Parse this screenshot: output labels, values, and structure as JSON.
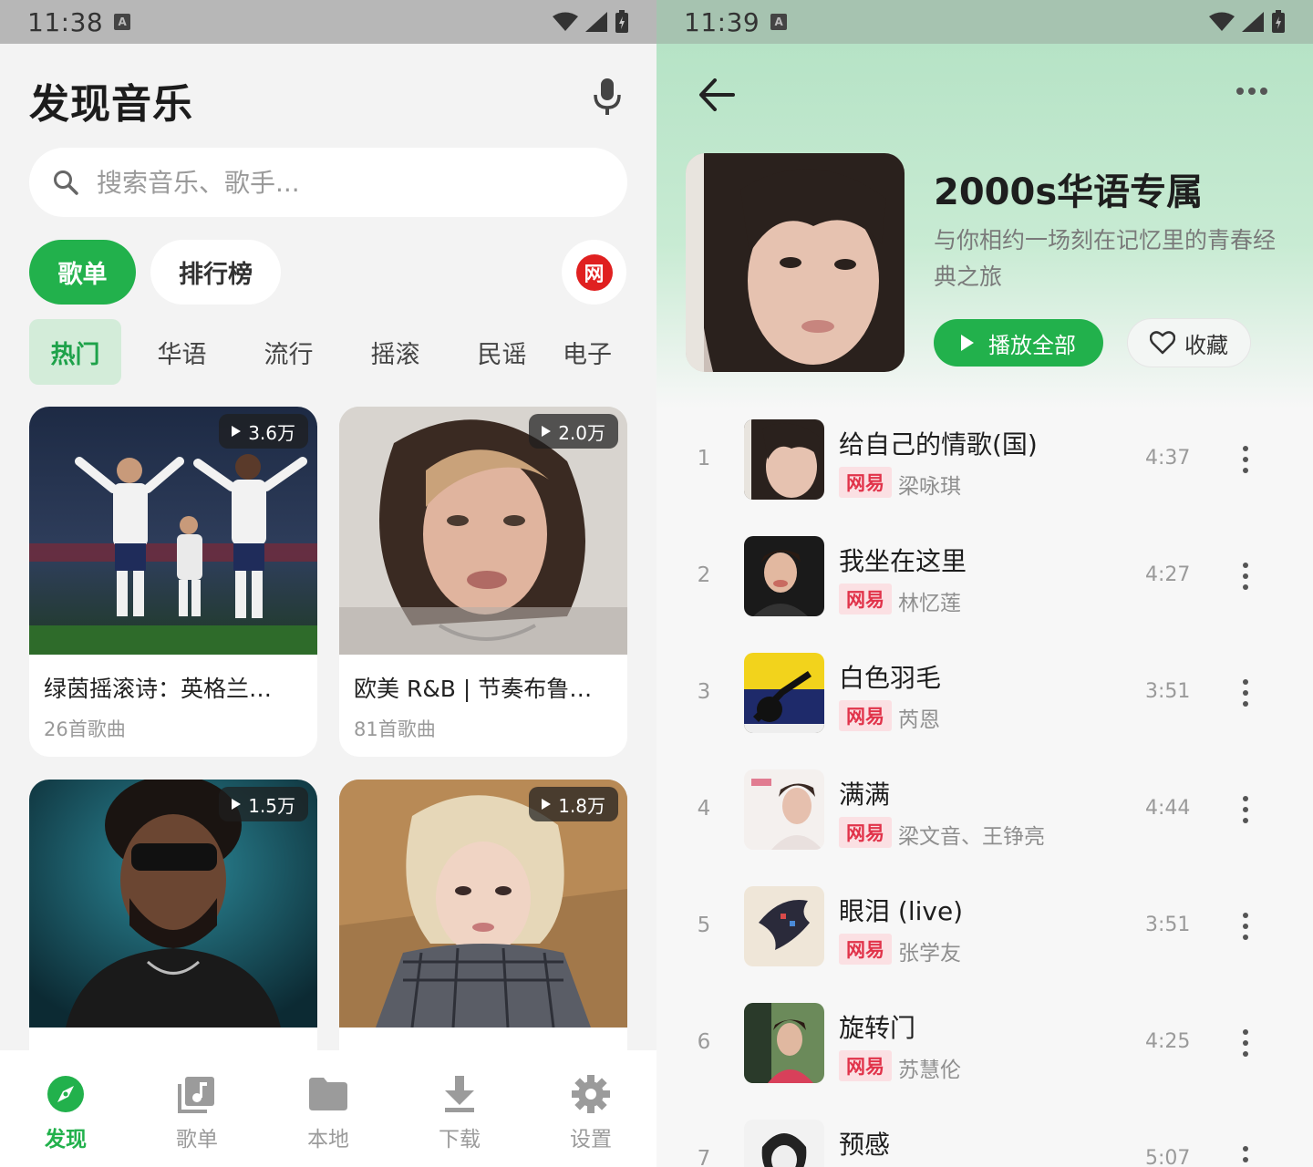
{
  "left": {
    "status": {
      "time": "11:38",
      "badge": "A"
    },
    "title": "发现音乐",
    "search": {
      "placeholder": "搜索音乐、歌手..."
    },
    "pills": {
      "active": "歌单",
      "inactive": "排行榜"
    },
    "source_badge": "网",
    "categories": [
      "热门",
      "华语",
      "流行",
      "摇滚",
      "民谣",
      "电子"
    ],
    "cards": [
      {
        "title": "绿茵摇滚诗：英格兰…",
        "count": "26首歌曲",
        "plays": "3.6万"
      },
      {
        "title": "欧美 R&B | 节奏布鲁…",
        "count": "81首歌曲",
        "plays": "2.0万"
      },
      {
        "title": "",
        "count": "",
        "plays": "1.5万"
      },
      {
        "title": "",
        "count": "",
        "plays": "1.8万"
      }
    ],
    "nav": [
      {
        "label": "发现",
        "icon": "compass-icon",
        "active": true
      },
      {
        "label": "歌单",
        "icon": "playlist-icon",
        "active": false
      },
      {
        "label": "本地",
        "icon": "folder-icon",
        "active": false
      },
      {
        "label": "下载",
        "icon": "download-icon",
        "active": false
      },
      {
        "label": "设置",
        "icon": "gear-icon",
        "active": false
      }
    ]
  },
  "right": {
    "status": {
      "time": "11:39",
      "badge": "A"
    },
    "playlist": {
      "title": "2000s华语专属",
      "desc": "与你相约一场刻在记忆里的青春经典之旅",
      "play_all": "播放全部",
      "favorite": "收藏"
    },
    "songs": [
      {
        "idx": "1",
        "name": "给自己的情歌(国)",
        "tag": "网易",
        "artist": "梁咏琪",
        "dur": "4:37"
      },
      {
        "idx": "2",
        "name": "我坐在这里",
        "tag": "网易",
        "artist": "林忆莲",
        "dur": "4:27"
      },
      {
        "idx": "3",
        "name": "白色羽毛",
        "tag": "网易",
        "artist": "芮恩",
        "dur": "3:51"
      },
      {
        "idx": "4",
        "name": "满满",
        "tag": "网易",
        "artist": "梁文音、王铮亮",
        "dur": "4:44"
      },
      {
        "idx": "5",
        "name": "眼泪 (live)",
        "tag": "网易",
        "artist": "张学友",
        "dur": "3:51"
      },
      {
        "idx": "6",
        "name": "旋转门",
        "tag": "网易",
        "artist": "苏慧伦",
        "dur": "4:25"
      },
      {
        "idx": "7",
        "name": "预感",
        "tag": "",
        "artist": "",
        "dur": "5:07"
      }
    ]
  },
  "colors": {
    "accent": "#22b14c",
    "tag_bg": "#fbe0e3",
    "tag_fg": "#e1334a"
  }
}
